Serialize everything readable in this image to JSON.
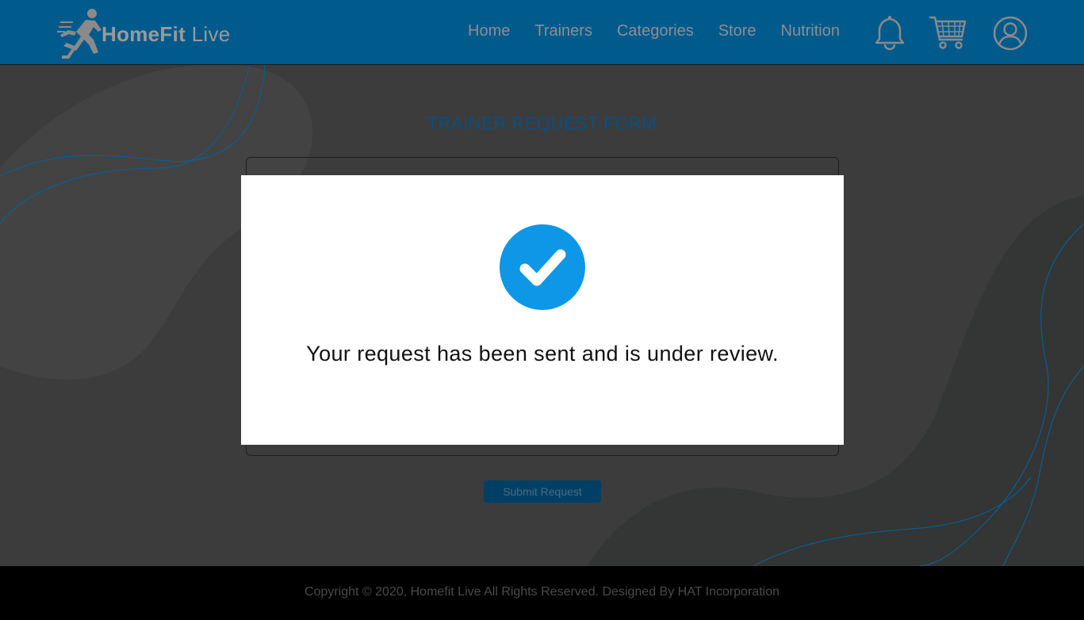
{
  "header": {
    "logo": {
      "bold": "HomeFit",
      "light": " Live"
    },
    "nav": [
      {
        "label": "Home"
      },
      {
        "label": "Trainers"
      },
      {
        "label": "Categories"
      },
      {
        "label": "Store"
      },
      {
        "label": "Nutrition"
      }
    ],
    "icons": [
      "bell-icon",
      "cart-icon",
      "user-icon"
    ]
  },
  "form": {
    "title": "TRAINER REQUEST FORM",
    "submit_label": "Submit Request"
  },
  "modal": {
    "icon": "check-circle-icon",
    "message": "Your request has been sent and is under review."
  },
  "footer": {
    "copyright": "Copyright © 2020, Homefit Live All Rights Reserved. Designed By HAT Incorporation"
  },
  "colors": {
    "header_bg": "#005a8c",
    "overlay_bg": "#3c3c3c",
    "accent": "#0d97e6",
    "footer_bg": "#000000"
  }
}
